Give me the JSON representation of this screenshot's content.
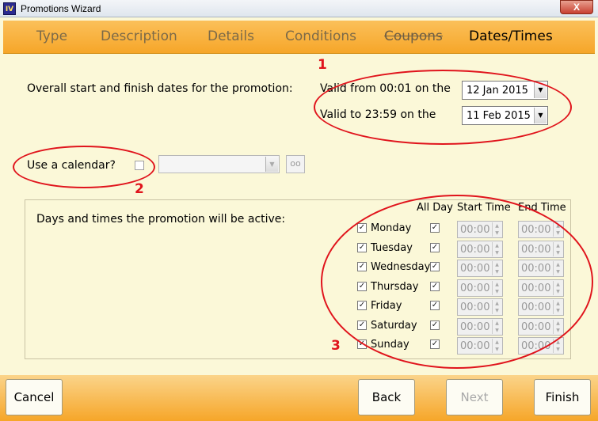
{
  "window": {
    "title": "Promotions Wizard",
    "logo_text": "IV",
    "close_label": "X"
  },
  "tabs": [
    {
      "label": "Type"
    },
    {
      "label": "Description"
    },
    {
      "label": "Details"
    },
    {
      "label": "Conditions"
    },
    {
      "label": "Coupons"
    },
    {
      "label": "Dates/Times"
    }
  ],
  "dates": {
    "overall_label": "Overall start and finish dates for the promotion:",
    "valid_from_label": "Valid from 00:01 on the",
    "valid_from_value": "12 Jan 2015",
    "valid_to_label": "Valid to 23:59 on the",
    "valid_to_value": "11 Feb 2015"
  },
  "calendar": {
    "label": "Use a calendar?",
    "value": ""
  },
  "days_section": {
    "label": "Days and times the promotion will be active:",
    "col_all_day": "All Day",
    "col_start": "Start Time",
    "col_end": "End Time",
    "days": [
      {
        "name": "Monday",
        "checked": true,
        "all_day": true,
        "start": "00:00",
        "end": "00:00"
      },
      {
        "name": "Tuesday",
        "checked": true,
        "all_day": true,
        "start": "00:00",
        "end": "00:00"
      },
      {
        "name": "Wednesday",
        "checked": true,
        "all_day": true,
        "start": "00:00",
        "end": "00:00"
      },
      {
        "name": "Thursday",
        "checked": true,
        "all_day": true,
        "start": "00:00",
        "end": "00:00"
      },
      {
        "name": "Friday",
        "checked": true,
        "all_day": true,
        "start": "00:00",
        "end": "00:00"
      },
      {
        "name": "Saturday",
        "checked": true,
        "all_day": true,
        "start": "00:00",
        "end": "00:00"
      },
      {
        "name": "Sunday",
        "checked": true,
        "all_day": true,
        "start": "00:00",
        "end": "00:00"
      }
    ]
  },
  "annotations": [
    "1",
    "2",
    "3"
  ],
  "buttons": {
    "cancel": "Cancel",
    "back": "Back",
    "next": "Next",
    "finish": "Finish"
  },
  "colors": {
    "tab_bar": "#f6a629",
    "background": "#fbf8d8",
    "annotation": "#e0141c"
  },
  "icons": {
    "calendar_lookup": "glasses-icon",
    "checkmark": "✓"
  }
}
